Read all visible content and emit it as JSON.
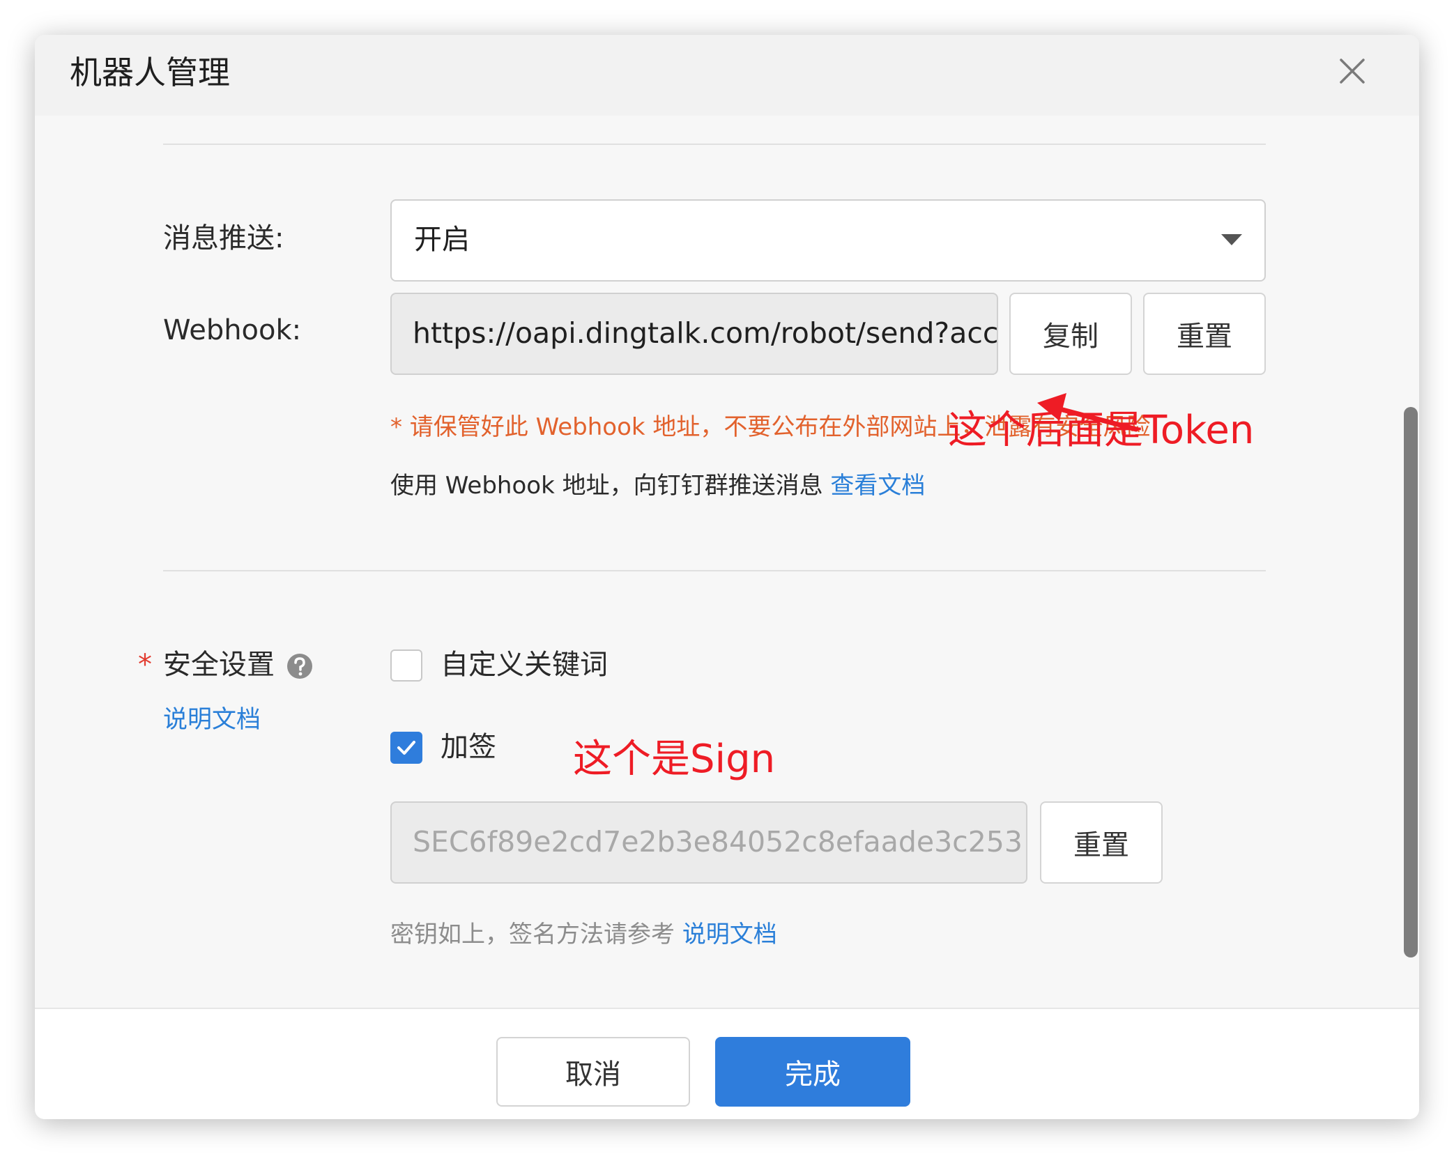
{
  "dialog": {
    "title": "机器人管理"
  },
  "message_push": {
    "label": "消息推送:",
    "selected": "开启"
  },
  "webhook": {
    "label": "Webhook:",
    "value": "https://oapi.dingtalk.com/robot/send?acc",
    "copy_label": "复制",
    "reset_label": "重置",
    "warning": "* 请保管好此 Webhook 地址，不要公布在外部网站上，泄露有安全风险",
    "hint": "使用 Webhook 地址，向钉钉群推送消息",
    "doc_link": "查看文档"
  },
  "security": {
    "required_mark": "*",
    "label": "安全设置",
    "doc_link": "说明文档",
    "options": {
      "keyword_label": "自定义关键词",
      "keyword_checked": false,
      "sign_label": "加签",
      "sign_checked": true
    },
    "secret_value": "SEC6f89e2cd7e2b3e84052c8efaade3c253",
    "secret_reset_label": "重置",
    "secret_hint": "密钥如上，签名方法请参考",
    "secret_doc_link": "说明文档"
  },
  "footer": {
    "cancel_label": "取消",
    "done_label": "完成"
  },
  "annotations": {
    "token_note": "这个后面是Token",
    "sign_note": "这个是Sign",
    "color": "#ee1c25"
  },
  "colors": {
    "accent": "#2f7ddc",
    "link": "#2a7fd8",
    "warning": "#e2622d",
    "required": "#e23b2f"
  }
}
